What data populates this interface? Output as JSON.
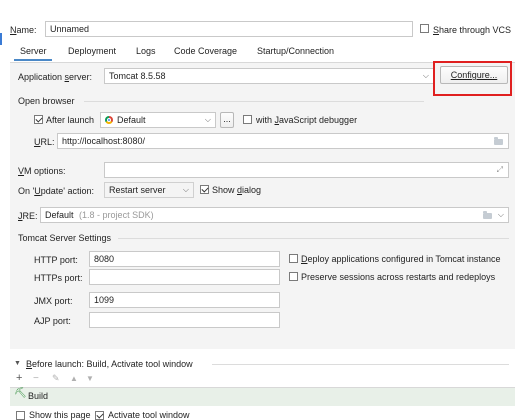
{
  "header": {
    "name_label": "Name:",
    "name_value": "Unnamed",
    "share_label": "Share through VCS"
  },
  "tabs": [
    {
      "label": "Server",
      "active": true
    },
    {
      "label": "Deployment"
    },
    {
      "label": "Logs"
    },
    {
      "label": "Code Coverage"
    },
    {
      "label": "Startup/Connection"
    }
  ],
  "app_server": {
    "label": "Application server:",
    "value": "Tomcat 8.5.58",
    "configure_label": "Configure..."
  },
  "open_browser": {
    "section_label": "Open browser",
    "after_launch_label": "After launch",
    "browser_value": "Default",
    "dots_label": "...",
    "js_debugger_label": "with JavaScript debugger",
    "url_label": "URL:",
    "url_value": "http://localhost:8080/"
  },
  "vm_options": {
    "label": "VM options:"
  },
  "on_update": {
    "label": "On 'Update' action:",
    "value": "Restart server",
    "show_dialog_label": "Show dialog"
  },
  "jre": {
    "label": "JRE:",
    "value": "Default",
    "hint": "(1.8 - project SDK)"
  },
  "tomcat": {
    "section_label": "Tomcat Server Settings",
    "http_label": "HTTP port:",
    "http_value": "8080",
    "https_label": "HTTPs port:",
    "https_value": "",
    "jmx_label": "JMX port:",
    "jmx_value": "1099",
    "ajp_label": "AJP port:",
    "ajp_value": "",
    "deploy_label": "Deploy applications configured in Tomcat instance",
    "preserve_label": "Preserve sessions across restarts and redeploys"
  },
  "before_launch": {
    "label": "Before launch: Build, Activate tool window",
    "item_label": "Build",
    "show_page_label": "Show this page",
    "activate_label": "Activate tool window"
  },
  "colors": {
    "highlight": "#e02020",
    "accent": "#3a7bd5"
  }
}
